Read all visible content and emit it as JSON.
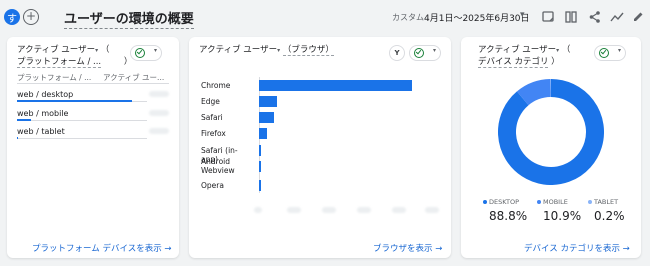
{
  "header": {
    "avatar_letter": "す",
    "add_label": "+",
    "title": "ユーザーの環境の概要",
    "date_label": "カスタム",
    "date_range": "4月1日～2025年6月30日",
    "date_caret": "▾"
  },
  "card1": {
    "title_line1": "アクティブ ユーザー",
    "title_paren": "（",
    "title_line2": "プラットフォーム / ...",
    "title_close": "）",
    "col_dimension": "プラットフォーム / ...",
    "col_metric": "アクティブ ユー...",
    "rows": [
      {
        "label": "web / desktop",
        "share": 0.888
      },
      {
        "label": "web / mobile",
        "share": 0.109
      },
      {
        "label": "web / tablet",
        "share": 0.002
      }
    ],
    "link": "プラットフォーム デバイスを表示 →"
  },
  "card2": {
    "title": "アクティブ ユーザー",
    "title_paren": "（ブラウザ）",
    "y_label": "Y",
    "link": "ブラウザを表示 →",
    "bars": [
      {
        "label": "Chrome",
        "value": 100
      },
      {
        "label": "Edge",
        "value": 12
      },
      {
        "label": "Safari",
        "value": 10
      },
      {
        "label": "Firefox",
        "value": 5
      },
      {
        "label": "Safari (in-app)",
        "value": 1
      },
      {
        "label": "Android Webview",
        "value": 0.5
      },
      {
        "label": "Opera",
        "value": 0.5
      }
    ]
  },
  "card3": {
    "title_line1": "アクティブ ユーザー",
    "title_paren": "（",
    "title_line2": "デバイス カテゴリ",
    "title_close": "）",
    "stats": [
      {
        "name": "DESKTOP",
        "value": "88.8%",
        "color": "#1a73e8"
      },
      {
        "name": "MOBILE",
        "value": "10.9%",
        "color": "#4285f4"
      },
      {
        "name": "TABLET",
        "value": "0.2%",
        "color": "#8ab4f8"
      }
    ],
    "link": "デバイス カテゴリを表示 →"
  },
  "chart_data": [
    {
      "type": "bar",
      "categories": [
        "Chrome",
        "Edge",
        "Safari",
        "Firefox",
        "Safari (in-app)",
        "Android Webview",
        "Opera"
      ],
      "values": [
        100,
        12,
        10,
        5,
        1,
        0.5,
        0.5
      ]
    },
    {
      "type": "pie",
      "categories": [
        "DESKTOP",
        "MOBILE",
        "TABLET"
      ],
      "values": [
        88.8,
        10.9,
        0.2
      ],
      "colors": [
        "#1a73e8",
        "#4285f4",
        "#8ab4f8"
      ]
    }
  ]
}
